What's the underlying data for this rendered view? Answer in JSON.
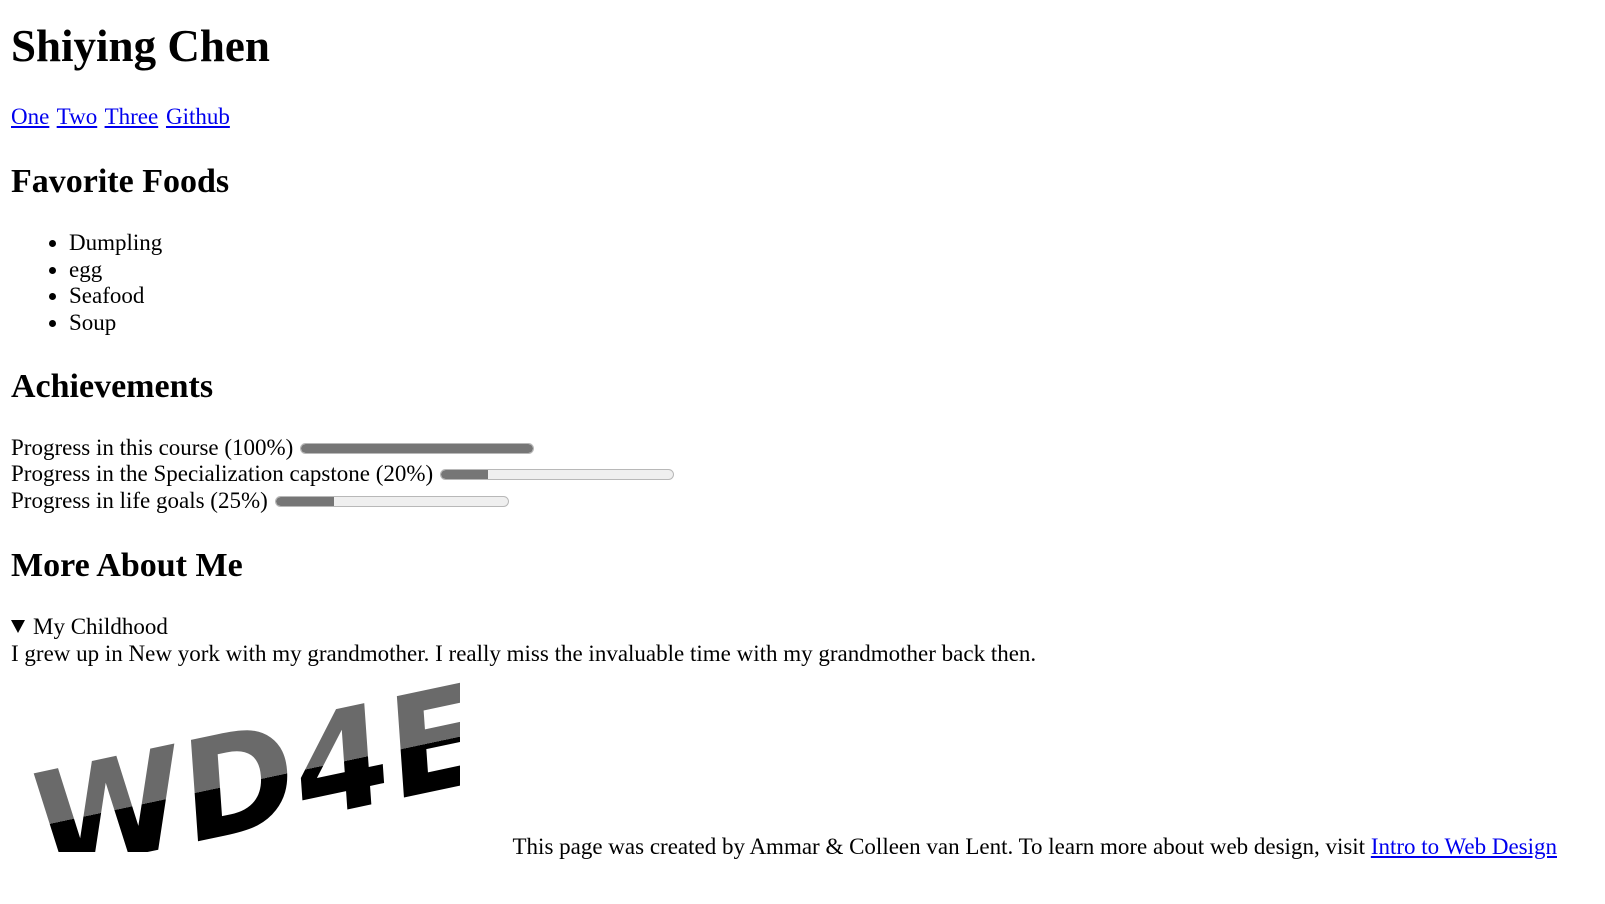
{
  "header": {
    "title": "Shiying Chen"
  },
  "nav": {
    "links": [
      "One",
      "Two",
      "Three",
      "Github"
    ]
  },
  "foods": {
    "heading": "Favorite Foods",
    "items": [
      "Dumpling",
      "egg",
      "Seafood",
      "Soup"
    ]
  },
  "achievements": {
    "heading": "Achievements",
    "items": [
      {
        "label": "Progress in this course (100%)",
        "value": 1.0
      },
      {
        "label": "Progress in the Specialization capstone (20%)",
        "value": 0.2
      },
      {
        "label": "Progress in life goals (25%)",
        "value": 0.25
      }
    ]
  },
  "more": {
    "heading": "More About Me",
    "summary": "My Childhood",
    "text": "I grew up in New york with my grandmother. I really miss the invaluable time with my grandmother back then."
  },
  "logo": {
    "text": "WD4E"
  },
  "footer": {
    "text": "This page was created by Ammar & Colleen van Lent. To learn more about web design, visit ",
    "link": "Intro to Web Design"
  },
  "colors": {
    "link": "#0000ee",
    "progress_fill": "#767676",
    "progress_track": "#efefef"
  }
}
